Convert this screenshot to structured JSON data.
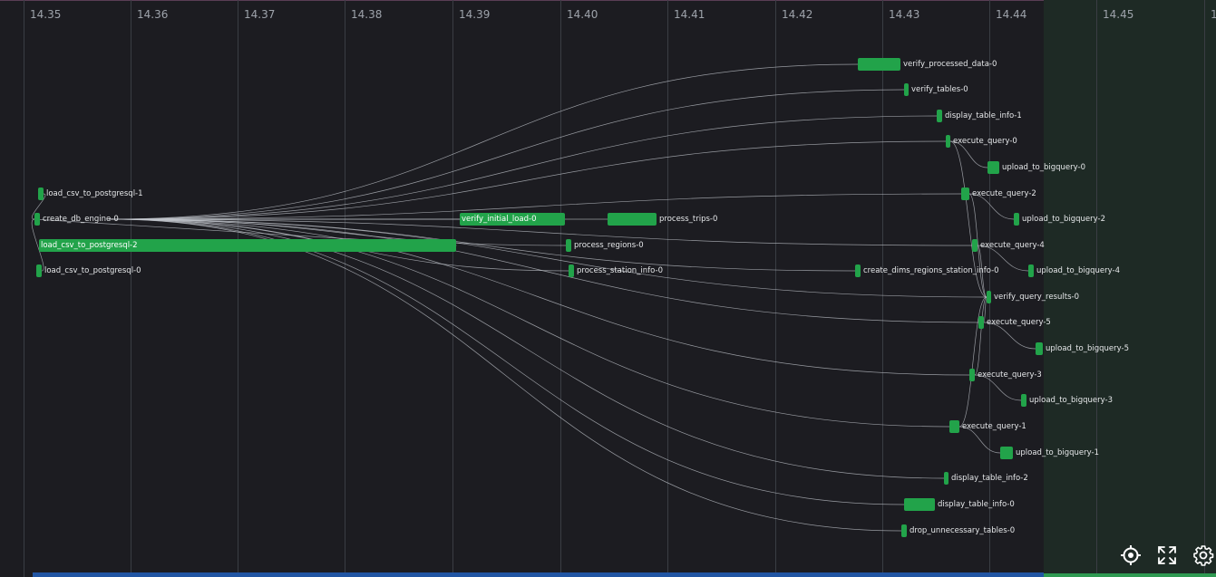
{
  "timeline": {
    "ticks": [
      "14.35",
      "14.36",
      "14.37",
      "14.38",
      "14.39",
      "14.40",
      "14.41",
      "14.42",
      "14.43",
      "14.44",
      "14.45",
      "1"
    ]
  },
  "colors": {
    "background": "#1c1c21",
    "task_bar": "#22a34a",
    "now_region": "#1e2a25",
    "progress_bar": "#2155a3"
  },
  "tasks": [
    {
      "id": "verify_processed_data",
      "label": "verify_processed_data-0"
    },
    {
      "id": "verify_tables",
      "label": "verify_tables-0"
    },
    {
      "id": "display_table_info_1",
      "label": "display_table_info-1"
    },
    {
      "id": "execute_query_0",
      "label": "execute_query-0"
    },
    {
      "id": "upload_bq_0",
      "label": "upload_to_bigquery-0"
    },
    {
      "id": "load_csv_1",
      "label": "load_csv_to_postgresql-1"
    },
    {
      "id": "execute_query_2",
      "label": "execute_query-2"
    },
    {
      "id": "create_db_engine",
      "label": "create_db_engine-0"
    },
    {
      "id": "verify_initial_load",
      "label": "verify_initial_load-0"
    },
    {
      "id": "process_trips",
      "label": "process_trips-0"
    },
    {
      "id": "upload_bq_2",
      "label": "upload_to_bigquery-2"
    },
    {
      "id": "load_csv_2",
      "label": "load_csv_to_postgresql-2"
    },
    {
      "id": "process_regions",
      "label": "process_regions-0"
    },
    {
      "id": "execute_query_4",
      "label": "execute_query-4"
    },
    {
      "id": "load_csv_0",
      "label": "load_csv_to_postgresql-0"
    },
    {
      "id": "process_station_info",
      "label": "process_station_info-0"
    },
    {
      "id": "create_dims",
      "label": "create_dims_regions_station_info-0"
    },
    {
      "id": "upload_bq_4",
      "label": "upload_to_bigquery-4"
    },
    {
      "id": "verify_query_results",
      "label": "verify_query_results-0"
    },
    {
      "id": "execute_query_5",
      "label": "execute_query-5"
    },
    {
      "id": "upload_bq_5",
      "label": "upload_to_bigquery-5"
    },
    {
      "id": "execute_query_3",
      "label": "execute_query-3"
    },
    {
      "id": "upload_bq_3",
      "label": "upload_to_bigquery-3"
    },
    {
      "id": "execute_query_1",
      "label": "execute_query-1"
    },
    {
      "id": "upload_bq_1",
      "label": "upload_to_bigquery-1"
    },
    {
      "id": "display_table_info_2",
      "label": "display_table_info-2"
    },
    {
      "id": "display_table_info_0",
      "label": "display_table_info-0"
    },
    {
      "id": "drop_unnecessary",
      "label": "drop_unnecessary_tables-0"
    }
  ],
  "controls": [
    {
      "name": "locate-icon"
    },
    {
      "name": "fullscreen-icon"
    },
    {
      "name": "settings-gear-icon"
    }
  ]
}
